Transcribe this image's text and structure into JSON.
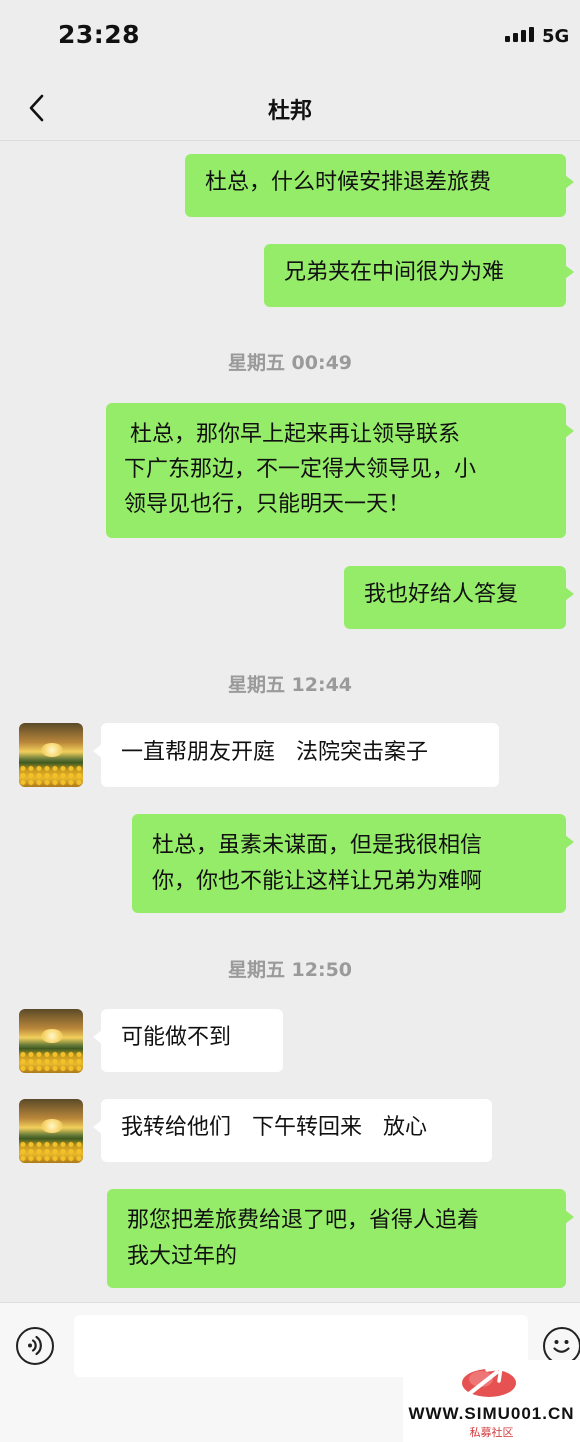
{
  "status_bar": {
    "time": "23:28",
    "network": "5G"
  },
  "nav": {
    "title": "杜邦"
  },
  "messages": [
    {
      "type": "out",
      "text": "杜总，什么时候安排退差旅费"
    },
    {
      "type": "out",
      "text": "兄弟夹在中间很为为难"
    },
    {
      "type": "time",
      "text": "星期五 00:49"
    },
    {
      "type": "out",
      "lines": [
        "杜总，那你早上起来再让领导联系",
        "下广东那边，不一定得大领导见，小",
        "领导见也行，只能明天一天！"
      ]
    },
    {
      "type": "out",
      "text": "我也好给人答复"
    },
    {
      "type": "time",
      "text": "星期五 12:44"
    },
    {
      "type": "in",
      "text": "一直帮朋友开庭   法院突击案子"
    },
    {
      "type": "out",
      "lines": [
        "杜总，虽素未谋面，但是我很相信",
        "你，你也不能让这样让兄弟为难啊"
      ]
    },
    {
      "type": "time",
      "text": "星期五 12:50"
    },
    {
      "type": "in",
      "text": "可能做不到"
    },
    {
      "type": "in",
      "text": "我转给他们   下午转回来   放心"
    },
    {
      "type": "out",
      "lines": [
        "那您把差旅费给退了吧，省得人追着",
        "我大过年的"
      ]
    }
  ],
  "input_bar": {
    "placeholder": ""
  },
  "watermark": {
    "url": "WWW.SIMU001.CN",
    "sub": "私募社区"
  },
  "icons": {
    "back": "chevron-left-icon",
    "voice": "voice-icon",
    "emoji": "emoji-icon",
    "signal": "signal-bars-icon"
  },
  "colors": {
    "outgoing_bubble": "#95ec69",
    "incoming_bubble": "#ffffff",
    "background": "#ededed",
    "timestamp": "#9a9a9a"
  }
}
